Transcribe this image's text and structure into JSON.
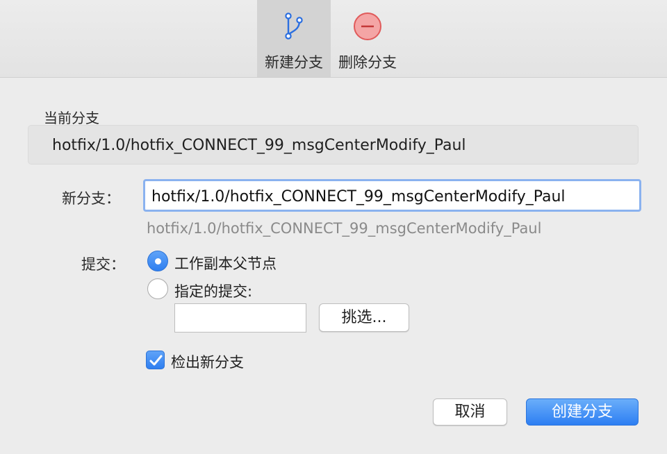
{
  "toolbar": {
    "new_branch": {
      "label": "新建分支",
      "icon": "branch-icon",
      "active": true
    },
    "delete_branch": {
      "label": "删除分支",
      "icon": "minus-circle-icon",
      "active": false
    }
  },
  "current_branch": {
    "label": "当前分支",
    "value": "hotfix/1.0/hotfix_CONNECT_99_msgCenterModify_Paul"
  },
  "new_branch": {
    "label": "新分支：",
    "value": "hotfix/1.0/hotfix_CONNECT_99_msgCenterModify_Paul",
    "preview": "hotfix/1.0/hotfix_CONNECT_99_msgCenterModify_Paul"
  },
  "commit": {
    "label": "提交：",
    "options": [
      {
        "label": "工作副本父节点",
        "selected": true
      },
      {
        "label": "指定的提交:",
        "selected": false
      }
    ],
    "specified_value": "",
    "pick_button": "挑选..."
  },
  "checkout": {
    "label": "检出新分支",
    "checked": true
  },
  "actions": {
    "cancel": "取消",
    "create": "创建分支"
  },
  "colors": {
    "accent": "#2f7ff0",
    "delete_icon": "#e05a5a",
    "focus_ring": "#8ab2ef"
  }
}
